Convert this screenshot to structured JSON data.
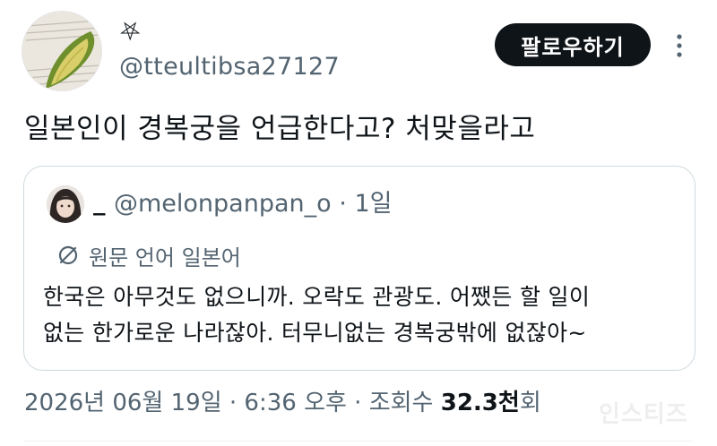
{
  "author": {
    "display_name": "⛧",
    "handle": "@tteultibsa27127"
  },
  "actions": {
    "follow_label": "팔로우하기",
    "more_icon": "more-vertical-icon"
  },
  "tweet": {
    "text": "일본인이 경복궁을 언급한다고? 처맞을라고"
  },
  "quoted_tweet": {
    "display_name": "_",
    "handle": "@melonpanpan_o",
    "separator": "·",
    "time": "1일",
    "translate_label": "원문 언어 일본어",
    "text_line1": "한국은 아무것도 없으니까. 오락도 관광도. 어쨌든 할 일이",
    "text_line2": "없는 한가로운 나라잖아. 터무니없는 경복궁밖에 없잖아~"
  },
  "meta": {
    "datetime": "2026년 06월 19일 · 6:36 오후 · 조회수 ",
    "views_number": "32.3천",
    "views_suffix": "회"
  },
  "watermark": "인스티즈",
  "colors": {
    "primary_text": "#0f1419",
    "secondary_text": "#536471",
    "border": "#cfd9de",
    "button_bg": "#0f1419",
    "button_text": "#ffffff"
  }
}
